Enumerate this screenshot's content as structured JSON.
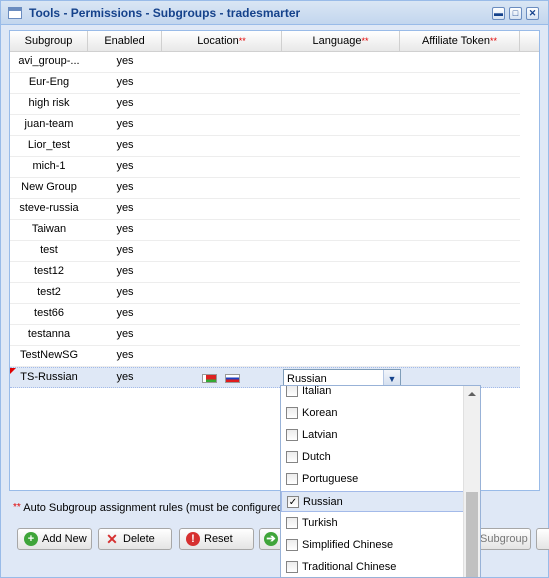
{
  "window": {
    "title": "Tools - Permissions - Subgroups - tradesmarter",
    "controls": {
      "minimize": "▬",
      "maximize": "□",
      "close": "✕"
    }
  },
  "grid": {
    "columns": [
      {
        "label": "Subgroup",
        "required": ""
      },
      {
        "label": "Enabled",
        "required": ""
      },
      {
        "label": "Location",
        "required": "**"
      },
      {
        "label": "Language",
        "required": "**"
      },
      {
        "label": "Affiliate Token",
        "required": "**"
      }
    ],
    "rows": [
      {
        "subgroup": "avi_group-...",
        "enabled": "yes"
      },
      {
        "subgroup": "Eur-Eng",
        "enabled": "yes"
      },
      {
        "subgroup": "high risk",
        "enabled": "yes"
      },
      {
        "subgroup": "juan-team",
        "enabled": "yes"
      },
      {
        "subgroup": "Lior_test",
        "enabled": "yes"
      },
      {
        "subgroup": "mich-1",
        "enabled": "yes"
      },
      {
        "subgroup": "New Group",
        "enabled": "yes"
      },
      {
        "subgroup": "steve-russia",
        "enabled": "yes"
      },
      {
        "subgroup": "Taiwan",
        "enabled": "yes"
      },
      {
        "subgroup": "test",
        "enabled": "yes"
      },
      {
        "subgroup": "test12",
        "enabled": "yes"
      },
      {
        "subgroup": "test2",
        "enabled": "yes"
      },
      {
        "subgroup": "test66",
        "enabled": "yes"
      },
      {
        "subgroup": "testanna",
        "enabled": "yes"
      },
      {
        "subgroup": "TestNewSG",
        "enabled": "yes"
      },
      {
        "subgroup": "TS-Russian",
        "enabled": "yes",
        "selected": true,
        "location_flags": [
          "belarus-flag-icon",
          "russia-flag-icon"
        ]
      }
    ],
    "editor": {
      "language_value": "Russian"
    }
  },
  "footnote": {
    "marker": "**",
    "text": "Auto Subgroup assignment rules (must be configured"
  },
  "buttons": [
    {
      "label": "Add New",
      "icon": "add-icon",
      "color": "#3fa53a"
    },
    {
      "label": "Delete",
      "icon": "delete-icon",
      "color": "#d63030"
    },
    {
      "label": "Reset",
      "icon": "reset-icon",
      "color": "#d63030"
    },
    {
      "label": "",
      "icon": "arrow-right-icon",
      "color": "#3fa53a"
    },
    {
      "label": "Subgroup",
      "icon": "",
      "color": ""
    }
  ],
  "dropdown": {
    "items": [
      {
        "label": "Italian",
        "checked": false
      },
      {
        "label": "Korean",
        "checked": false
      },
      {
        "label": "Latvian",
        "checked": false
      },
      {
        "label": "Dutch",
        "checked": false
      },
      {
        "label": "Portuguese",
        "checked": false
      },
      {
        "label": "Russian",
        "checked": true
      },
      {
        "label": "Turkish",
        "checked": false
      },
      {
        "label": "Simplified Chinese",
        "checked": false
      },
      {
        "label": "Traditional Chinese",
        "checked": false
      }
    ]
  }
}
